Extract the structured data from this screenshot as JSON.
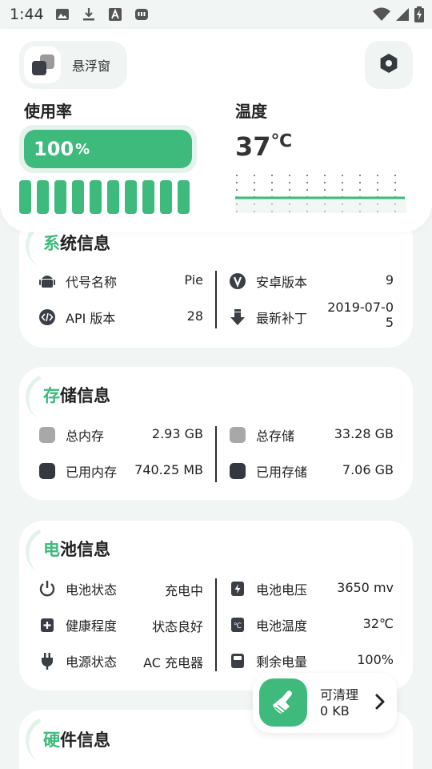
{
  "status_bar": {
    "time": "1:44"
  },
  "header": {
    "float_window_label": "悬浮窗",
    "usage_title": "使用率",
    "usage_value": "100",
    "usage_unit": "%",
    "usage_fraction": 1.0,
    "temp_title": "温度",
    "temp_value": "37",
    "temp_unit": "℃",
    "core_count": 10
  },
  "system_info": {
    "title_first": "系",
    "title_rest": "统信息",
    "left": [
      {
        "icon": "android-icon",
        "label": "代号名称",
        "value": "Pie"
      },
      {
        "icon": "code-icon",
        "label": "API 版本",
        "value": "28"
      }
    ],
    "right": [
      {
        "icon": "version-icon",
        "label": "安卓版本",
        "value": "9"
      },
      {
        "icon": "download-icon",
        "label": "最新补丁",
        "value_line1": "2019-07-0",
        "value_line2": "5"
      }
    ]
  },
  "storage_info": {
    "title_first": "存",
    "title_rest": "储信息",
    "left": [
      {
        "icon": "total-memory-icon",
        "label": "总内存",
        "value": "2.93 GB"
      },
      {
        "icon": "used-memory-icon",
        "label": "已用内存",
        "value": "740.25 MB"
      }
    ],
    "right": [
      {
        "icon": "total-storage-icon",
        "label": "总存储",
        "value": "33.28 GB"
      },
      {
        "icon": "used-storage-icon",
        "label": "已用存储",
        "value": "7.06 GB"
      }
    ]
  },
  "battery_info": {
    "title_first": "电",
    "title_rest": "池信息",
    "left": [
      {
        "icon": "power-icon",
        "label": "电池状态",
        "value": "充电中"
      },
      {
        "icon": "health-icon",
        "label": "健康程度",
        "value": "状态良好"
      },
      {
        "icon": "plug-icon",
        "label": "电源状态",
        "value": "AC 充电器"
      }
    ],
    "right": [
      {
        "icon": "voltage-icon",
        "label": "电池电压",
        "value": "3650 mv"
      },
      {
        "icon": "thermometer-icon",
        "label": "电池温度",
        "value": "32℃"
      },
      {
        "icon": "battery-level-icon",
        "label": "剩余电量",
        "value": "100%"
      }
    ]
  },
  "hardware_info": {
    "title_first": "硬",
    "title_rest": "件信息"
  },
  "clean": {
    "label": "可清理",
    "size": "0 KB"
  },
  "colors": {
    "accent": "#3dba7c",
    "accent_light": "#e6f2ec",
    "background": "#f1f5f3",
    "dark_square": "#343840",
    "gray_square": "#a8a8a8"
  }
}
